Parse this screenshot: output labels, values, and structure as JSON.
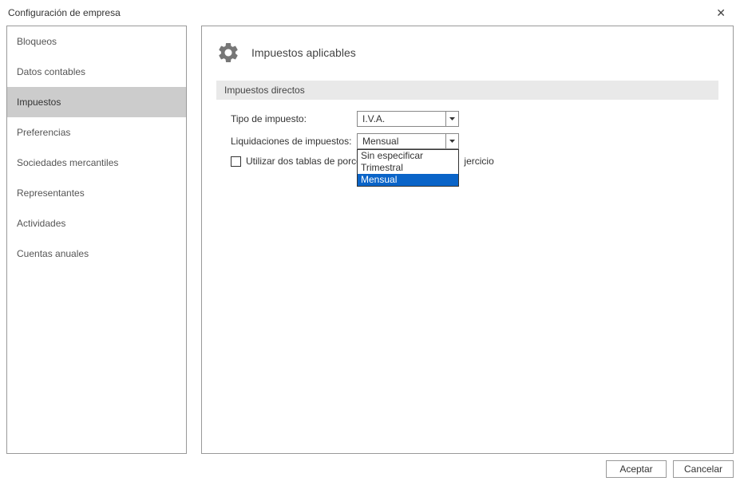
{
  "window": {
    "title": "Configuración de empresa"
  },
  "sidebar": {
    "items": [
      {
        "label": "Bloqueos"
      },
      {
        "label": "Datos contables"
      },
      {
        "label": "Impuestos",
        "selected": true
      },
      {
        "label": "Preferencias"
      },
      {
        "label": "Sociedades mercantiles"
      },
      {
        "label": "Representantes"
      },
      {
        "label": "Actividades"
      },
      {
        "label": "Cuentas anuales"
      }
    ]
  },
  "panel": {
    "title": "Impuestos aplicables",
    "section": "Impuestos directos",
    "fields": {
      "tipo_label": "Tipo de impuesto:",
      "tipo_value": "I.V.A.",
      "liq_label": "Liquidaciones de impuestos:",
      "liq_value": "Mensual",
      "liq_options": [
        {
          "label": "Sin especificar"
        },
        {
          "label": "Trimestral"
        },
        {
          "label": "Mensual",
          "highlighted": true
        }
      ],
      "checkbox_text_before": "Utilizar dos tablas de porcen",
      "checkbox_text_after": "jercicio"
    }
  },
  "footer": {
    "accept": "Aceptar",
    "cancel": "Cancelar"
  }
}
